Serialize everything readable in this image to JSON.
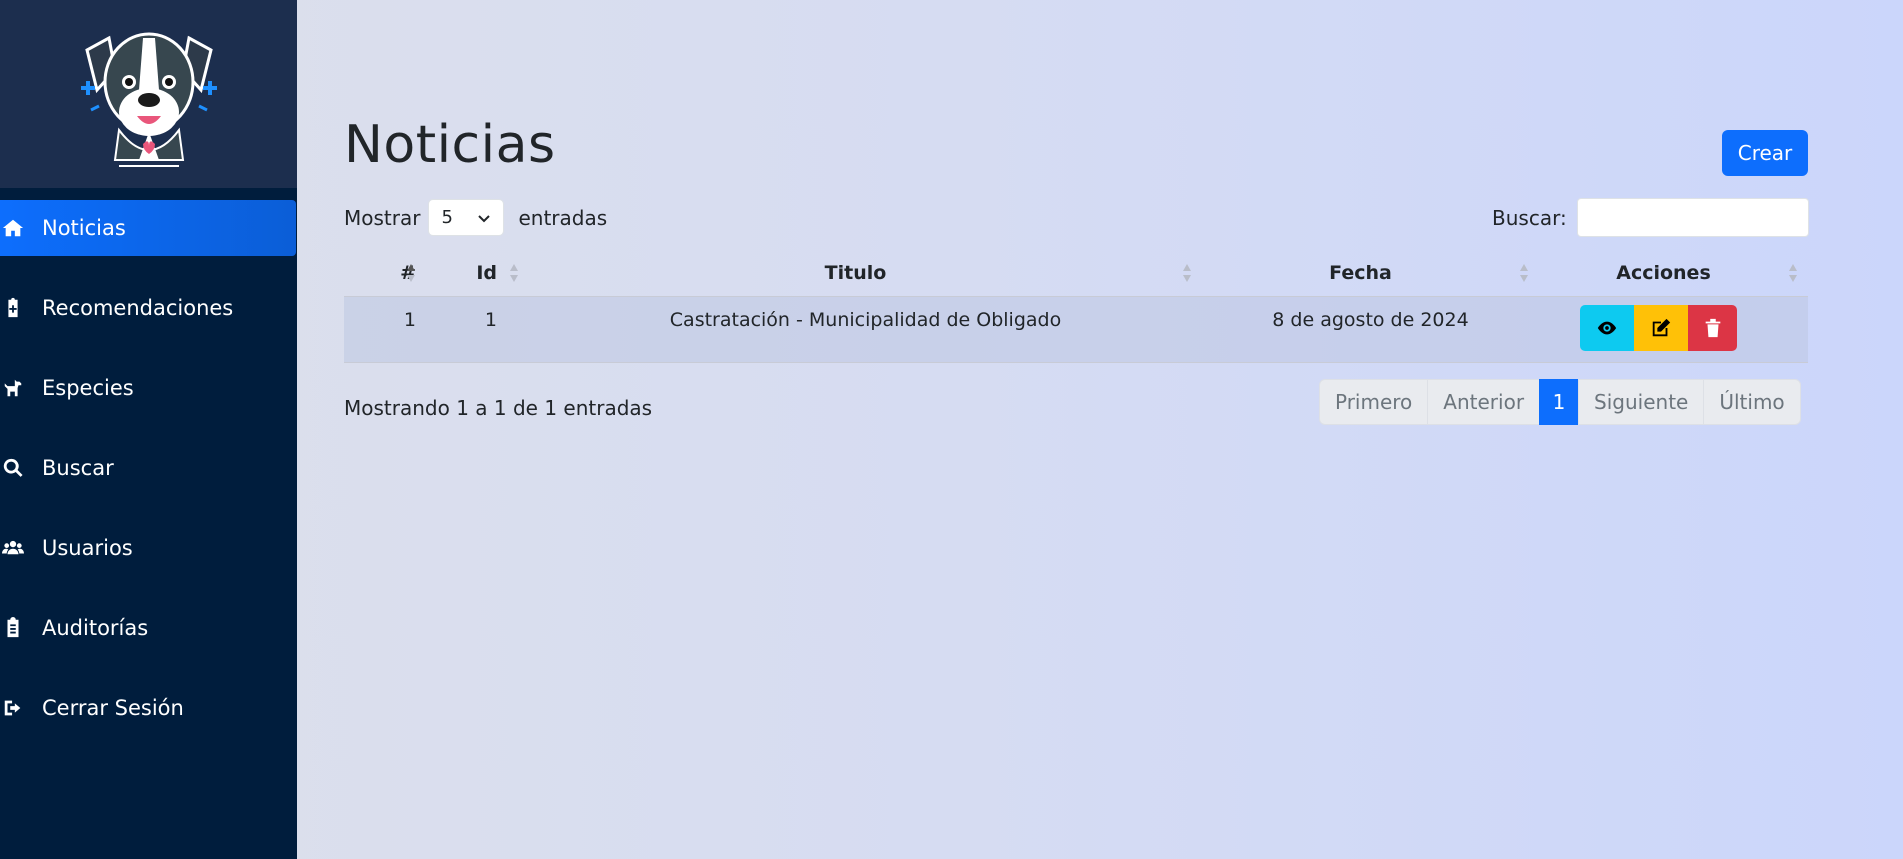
{
  "sidebar": {
    "items": [
      {
        "label": "Noticias",
        "icon": "home-icon",
        "active": true
      },
      {
        "label": "Recomendaciones",
        "icon": "clipboard-medical-icon"
      },
      {
        "label": "Especies",
        "icon": "dog-icon"
      },
      {
        "label": "Buscar",
        "icon": "search-icon"
      },
      {
        "label": "Usuarios",
        "icon": "users-icon"
      },
      {
        "label": "Auditorías",
        "icon": "clipboard-list-icon"
      },
      {
        "label": "Cerrar Sesión",
        "icon": "sign-out-icon"
      }
    ]
  },
  "page": {
    "title": "Noticias",
    "create_label": "Crear"
  },
  "length": {
    "show_label": "Mostrar",
    "value": "5",
    "entries_label": "entradas"
  },
  "search": {
    "label": "Buscar:",
    "value": ""
  },
  "table": {
    "headers": [
      "#",
      "Id",
      "Titulo",
      "Fecha",
      "Acciones"
    ],
    "rows": [
      {
        "num": "1",
        "id": "1",
        "titulo": "Castratación - Municipalidad de Obligado",
        "fecha": "8 de agosto de 2024"
      }
    ]
  },
  "info": "Mostrando 1 a 1 de 1 entradas",
  "pagination": {
    "first": "Primero",
    "prev": "Anterior",
    "current": "1",
    "next": "Siguiente",
    "last": "Último"
  },
  "colors": {
    "primary": "#0d6efd",
    "sidebar": "#001d3d",
    "view": "#0dcaf0",
    "edit": "#ffc107",
    "delete": "#dc3545"
  }
}
